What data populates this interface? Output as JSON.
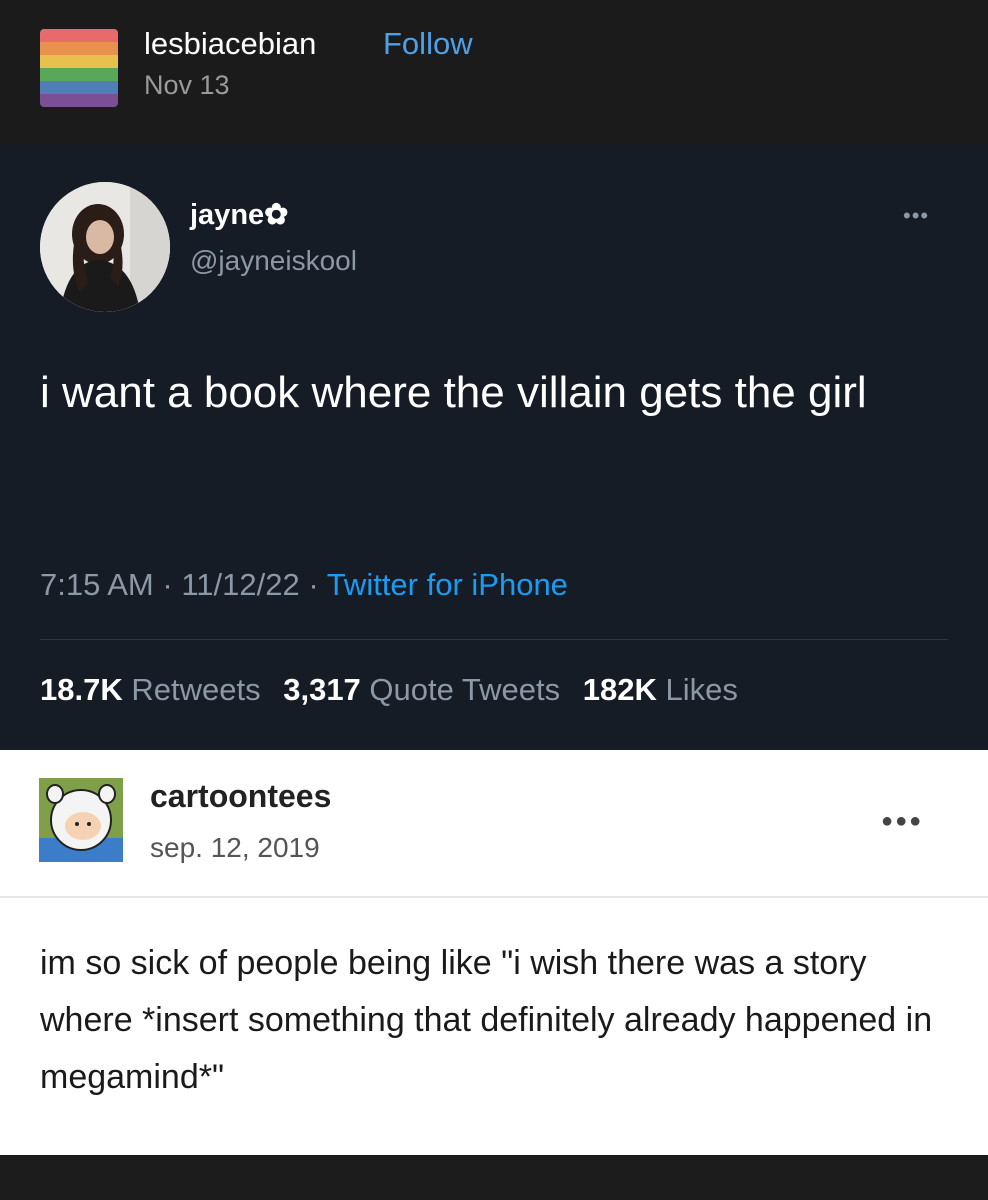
{
  "header": {
    "blog_name": "lesbiacebian",
    "follow_label": "Follow",
    "date": "Nov 13",
    "avatar_flag_colors": [
      "#e86b6b",
      "#e8904d",
      "#e8c04d",
      "#59a85a",
      "#4f7fb5",
      "#7a4f94"
    ]
  },
  "tweet": {
    "display_name": "jayne✿",
    "handle": "@jayneiskool",
    "more_icon": "more-horizontal-icon",
    "text": "i want a book where the villain gets the girl",
    "time": "7:15 AM",
    "date": "11/12/22",
    "source": "Twitter for iPhone",
    "retweets_count": "18.7K",
    "retweets_label": "Retweets",
    "quotes_count": "3,317",
    "quotes_label": "Quote Tweets",
    "likes_count": "182K",
    "likes_label": "Likes"
  },
  "reblog": {
    "blog_name": "cartoontees",
    "date": "sep. 12, 2019",
    "more_icon": "more-horizontal-icon",
    "text": "im so sick of people being like \"i wish there was a story where *insert something that definitely already happened in megamind*\""
  },
  "colors": {
    "tweet_bg": "#161c26",
    "link_blue": "#1d9bf0",
    "tumblr_follow": "#4ea1e8"
  }
}
